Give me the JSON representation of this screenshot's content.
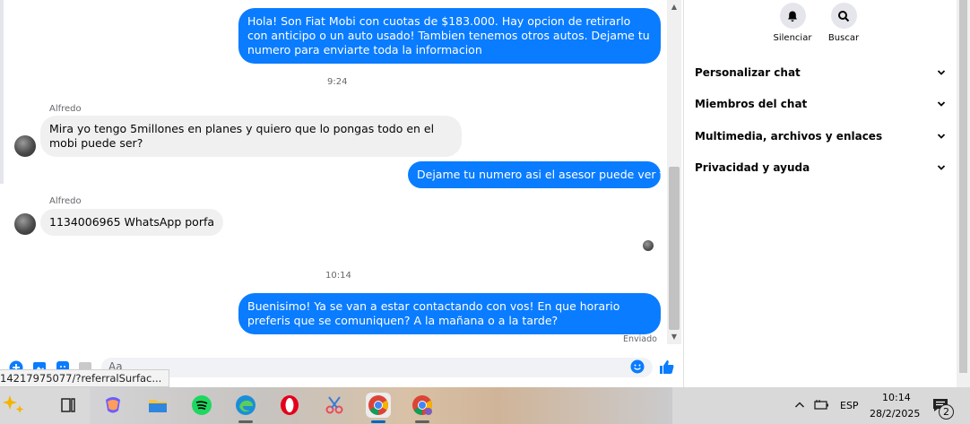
{
  "chat": {
    "messages": [
      {
        "dir": "out",
        "text": "Hola! Son Fiat Mobi con cuotas de $183.000. Hay opcion de retirarlo con anticipo o un auto usado! Tambien tenemos otros autos. Dejame tu numero para enviarte toda la informacion"
      },
      {
        "dir": "in",
        "sender": "Alfredo",
        "text": "Mira yo tengo 5millones en planes y quiero que lo pongas todo en el mobi puede ser?"
      },
      {
        "dir": "out",
        "text": "Dejame tu numero asi el asesor puede ver tu caso"
      },
      {
        "dir": "in",
        "sender": "Alfredo",
        "text": "1134006965 WhatsApp porfa"
      },
      {
        "dir": "out",
        "text": "Buenisimo! Ya se van a estar contactando con vos! En que horario preferis que se comuniquen? A la mañana o a la tarde?"
      }
    ],
    "timestamps": [
      "9:24",
      "10:14"
    ],
    "status": "Enviado"
  },
  "composer": {
    "placeholder": "Aa"
  },
  "status_url": "14217975077/?referralSurfac...",
  "panel": {
    "actions": [
      {
        "label": "Silenciar",
        "icon": "bell-icon"
      },
      {
        "label": "Buscar",
        "icon": "search-icon"
      }
    ],
    "sections": [
      {
        "label": "Personalizar chat"
      },
      {
        "label": "Miembros del chat"
      },
      {
        "label": "Multimedia, archivos y enlaces"
      },
      {
        "label": "Privacidad y ayuda"
      }
    ]
  },
  "taskbar": {
    "apps": [
      "copilot-icon",
      "task-view-icon",
      "copilot-app-icon",
      "file-explorer-icon",
      "spotify-icon",
      "edge-icon",
      "opera-icon",
      "snipping-icon",
      "chrome-icon",
      "chrome-profile-icon"
    ],
    "language": "ESP",
    "time": "10:14",
    "date": "28/2/2025",
    "notifications": "2"
  },
  "colors": {
    "accent": "#0a7cff",
    "incoming": "#f0f0f0"
  }
}
